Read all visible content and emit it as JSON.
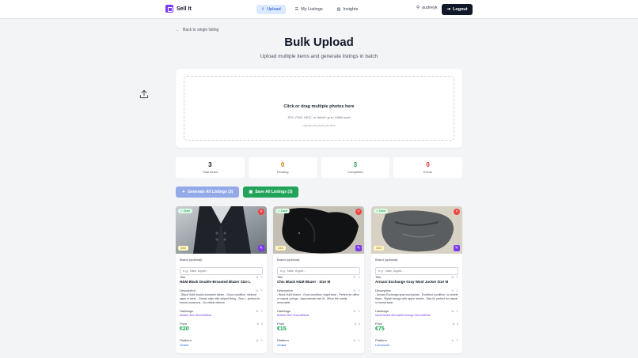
{
  "nav": {
    "brand": "Sell It",
    "links": [
      {
        "label": "Upload",
        "icon": "upload-icon",
        "active": true
      },
      {
        "label": "My Listings",
        "icon": "list-icon",
        "active": false
      },
      {
        "label": "Insights",
        "icon": "chart-icon",
        "active": false
      }
    ],
    "username": "audreyk",
    "logout": "Logout"
  },
  "page": {
    "back": "Back to single listing",
    "title": "Bulk Upload",
    "subtitle": "Upload multiple items and generate listings in batch"
  },
  "dropzone": {
    "main": "Click or drag multiple photos here",
    "sub": "JPG, PNG, HEIC, or WebP up to 10MB each",
    "hint": "Upload one photo per item"
  },
  "stats": [
    {
      "value": "3",
      "label": "Total Items",
      "color": "#111827"
    },
    {
      "value": "0",
      "label": "Pending",
      "color": "#d97706"
    },
    {
      "value": "3",
      "label": "Completed",
      "color": "#16a34a"
    },
    {
      "value": "0",
      "label": "Errors",
      "color": "#dc2626"
    }
  ],
  "actions": {
    "generate": "Generate All Listings (3)",
    "save": "Save All Listings (3)"
  },
  "labels": {
    "brand": "Brand (optional)",
    "brand_placeholder": "e.g., Nike, Apple...",
    "title": "Title",
    "description": "Description",
    "hashtags": "Hashtags",
    "price": "Price",
    "platform": "Platform",
    "done": "Done",
    "count": "1/10"
  },
  "items": [
    {
      "title": "H&M Black Double-Breasted Blazer Size L",
      "description": "- Black H&M double-breasted blazer - Good condition, minimal signs of wear - Classic style with striped lining - Size L, perfect for formal occasions - No visible defects",
      "hashtags": "#blazer #hm #formalWear",
      "price": "€20",
      "platform": "Vinted"
    },
    {
      "title": "Chic Black H&M Blazer - Size M",
      "description": "- Black H&M blazer - Good condition, slight wear - Perfect for office or casual outings - Approximate size M - Minor lint, easily removable",
      "hashtags": "#blazer #hm #casualWear",
      "price": "€15",
      "platform": "Vinted"
    },
    {
      "title": "Armani Exchange Gray Wool Jacket Size M",
      "description": "- Armani Exchange gray wool jacket - Excellent condition, no visible flaws - Stylish design with zipper details - Size M, perfect for casual or formal wear",
      "hashtags": "#woolJacket #ArmaniExchange #formalWear",
      "price": "€75",
      "platform": "Leboncoin"
    }
  ]
}
